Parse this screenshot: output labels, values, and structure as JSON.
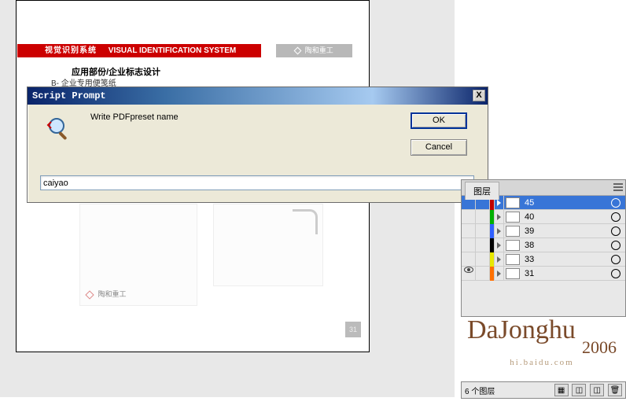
{
  "document": {
    "red_bar_cn": "视觉识别系统",
    "red_bar_en": "VISUAL IDENTIFICATION SYSTEM",
    "gray_tab_label": "陶和重工",
    "section_title": "应用部份/企业标志设计",
    "section_sub": "B- 企业专用便笺纸",
    "logo_text": "陶和重工",
    "page_number": "31"
  },
  "dialog": {
    "title": "Script Prompt",
    "message": "Write PDFpreset name",
    "ok_label": "OK",
    "cancel_label": "Cancel",
    "close_label": "X",
    "input_value": "caiyao"
  },
  "layers": {
    "tab_label": "图层",
    "rows": [
      {
        "name": "45",
        "color": "#c00000",
        "visible": false,
        "selected": true
      },
      {
        "name": "40",
        "color": "#00b000",
        "visible": false,
        "selected": false
      },
      {
        "name": "39",
        "color": "#3060ff",
        "visible": false,
        "selected": false
      },
      {
        "name": "38",
        "color": "#000000",
        "visible": false,
        "selected": false
      },
      {
        "name": "33",
        "color": "#e8e800",
        "visible": false,
        "selected": false
      },
      {
        "name": "31",
        "color": "#ff7000",
        "visible": true,
        "selected": false
      }
    ],
    "status_text": "6 个图层"
  },
  "signature": {
    "name": "DaJonghu",
    "year": "2006",
    "url": "hi.baidu.com"
  }
}
